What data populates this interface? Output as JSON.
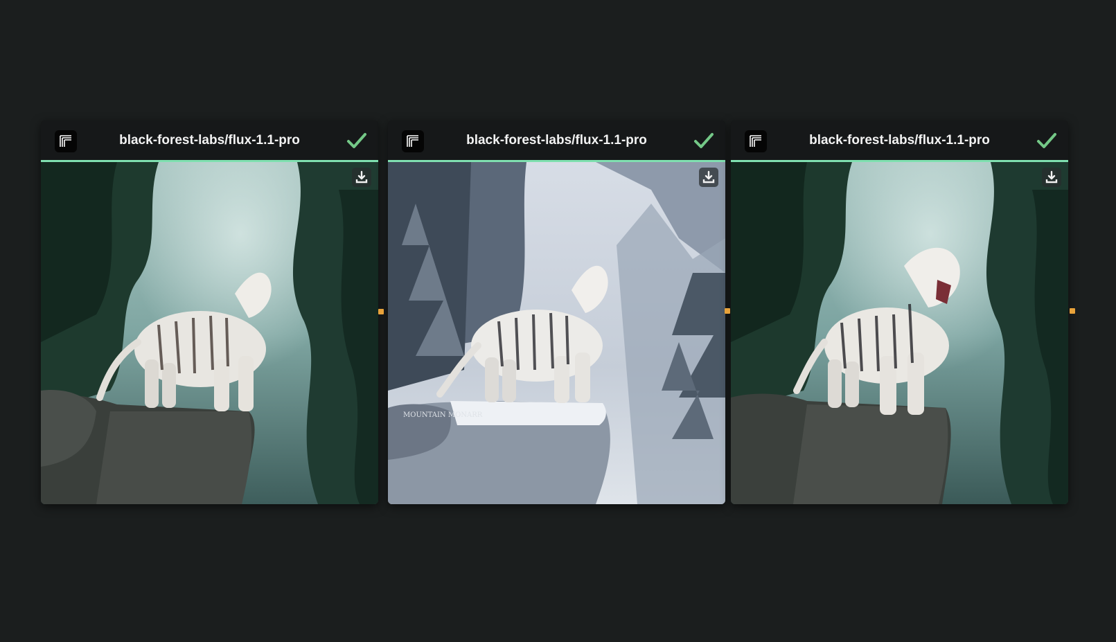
{
  "nodes": [
    {
      "model": "black-forest-labs/flux-1.1-pro",
      "status": "completed",
      "image": "white-tiger-jungle-cliff"
    },
    {
      "model": "black-forest-labs/flux-1.1-pro",
      "status": "completed",
      "image": "white-tiger-snowy-mountain",
      "rock_text": "MOUNTAIN MONARR"
    },
    {
      "model": "black-forest-labs/flux-1.1-pro",
      "status": "completed",
      "image": "white-tiger-roaring-jungle"
    }
  ],
  "icons": {
    "logo": "replicate-logo-icon",
    "status": "checkmark-icon",
    "download": "download-icon",
    "port": "output-port-connector"
  },
  "colors": {
    "background": "#1b1e1e",
    "header_underline": "#7fe0b0",
    "check": "#74c887",
    "port": "#e8a23a"
  }
}
